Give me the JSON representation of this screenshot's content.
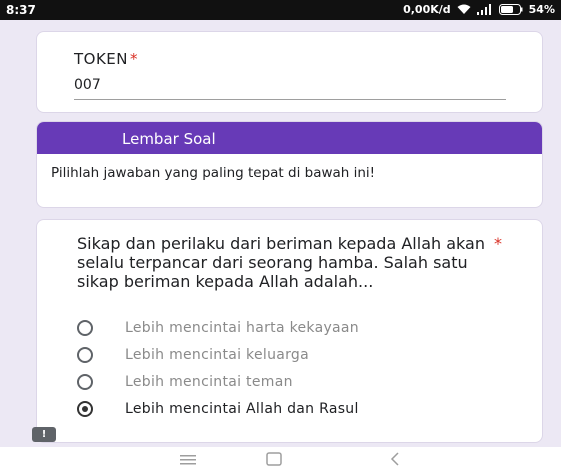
{
  "status_bar": {
    "time": "8:37",
    "network_speed": "0,00K/d",
    "battery": "54%"
  },
  "token": {
    "label": "TOKEN",
    "required_mark": "*",
    "value": "007"
  },
  "section": {
    "title": "Lembar Soal",
    "description": "Pilihlah jawaban yang paling tepat di bawah ini!"
  },
  "question": {
    "text": "Sikap dan perilaku dari beriman kepada Allah akan selalu terpancar dari seorang hamba. Salah satu sikap beriman kepada Allah adalah...",
    "required_mark": "*",
    "options": [
      {
        "label": "Lebih mencintai harta kekayaan",
        "selected": false
      },
      {
        "label": "Lebih mencintai keluarga",
        "selected": false
      },
      {
        "label": "Lebih mencintai teman",
        "selected": false
      },
      {
        "label": "Lebih mencintai Allah dan Rasul",
        "selected": true
      }
    ]
  },
  "feedback": {
    "label": "!"
  },
  "colors": {
    "accent": "#673ab7",
    "required": "#d93025",
    "background": "#ece8f4"
  }
}
